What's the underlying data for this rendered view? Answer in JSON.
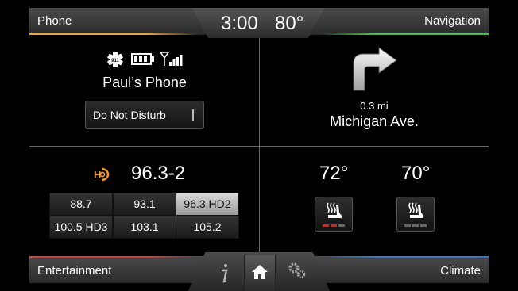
{
  "topbar": {
    "left_label": "Phone",
    "right_label": "Navigation",
    "time": "3:00",
    "outside_temp": "80°"
  },
  "phone": {
    "device_name": "Paul’s Phone",
    "dnd_label": "Do Not Disturb"
  },
  "navigation": {
    "distance": "0.3 mi",
    "street": "Michigan Ave."
  },
  "radio": {
    "station": "96.3-2",
    "presets": [
      "88.7",
      "93.1",
      "96.3 HD2",
      "100.5 HD3",
      "103.1",
      "105.2"
    ],
    "selected": "96.3 HD2"
  },
  "climate": {
    "left_temp": "72°",
    "right_temp": "70°"
  },
  "bottombar": {
    "left_label": "Entertainment",
    "right_label": "Climate"
  },
  "colors": {
    "phone": "#f2a623",
    "nav": "#3fbf4f",
    "entertainment": "#e23b3b",
    "climate": "#2d7bd6",
    "hd": "#f29a1c",
    "heat_on": "#e02020"
  },
  "icons": [
    "emergency-911-icon",
    "battery-icon",
    "signal-icon",
    "turn-right-arrow-icon",
    "hd-radio-icon",
    "heated-seat-icon",
    "info-icon",
    "home-icon",
    "settings-icon"
  ]
}
